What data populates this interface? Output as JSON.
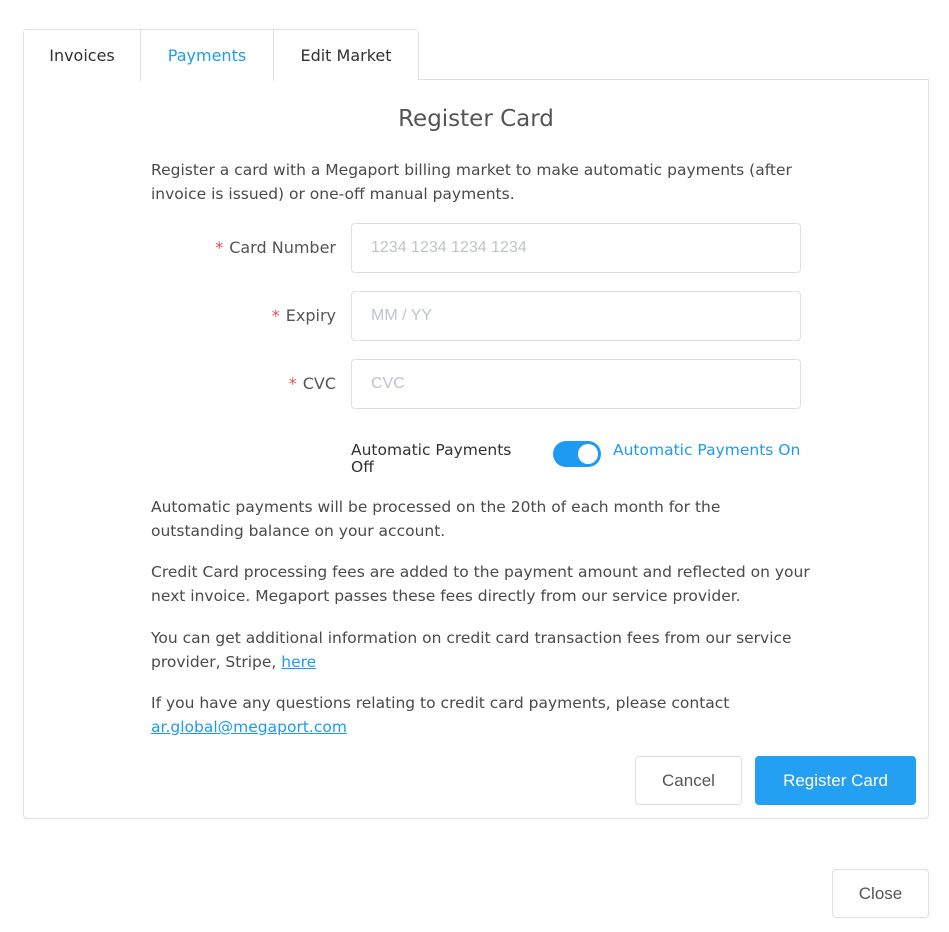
{
  "tabs": [
    {
      "label": "Invoices",
      "active": false
    },
    {
      "label": "Payments",
      "active": true
    },
    {
      "label": "Edit Market",
      "active": false
    }
  ],
  "form": {
    "title": "Register Card",
    "intro": "Register a card with a Megaport billing market to make automatic payments (after invoice is issued) or one-off manual payments.",
    "required_marker": "*",
    "card_number": {
      "label": "Card Number",
      "placeholder": "1234 1234 1234 1234",
      "value": ""
    },
    "expiry": {
      "label": "Expiry",
      "placeholder": "MM / YY",
      "value": ""
    },
    "cvc": {
      "label": "CVC",
      "placeholder": "CVC",
      "value": ""
    },
    "auto_payments": {
      "off_label": "Automatic Payments Off",
      "on_label": "Automatic Payments On",
      "enabled": true
    },
    "note_schedule": "Automatic payments will be processed on the 20th of each month for the outstanding balance on your account.",
    "note_fees": "Credit Card processing fees are added to the payment amount and reflected on your next invoice. Megaport passes these fees directly from our service provider.",
    "note_stripe_prefix": "You can get additional information on credit card transaction fees from our service provider, Stripe, ",
    "note_stripe_link": "here",
    "note_contact_prefix": "If you have any questions relating to credit card payments, please contact ",
    "note_contact_email": "ar.global@megaport.com",
    "cancel_label": "Cancel",
    "register_label": "Register Card"
  },
  "footer": {
    "close_label": "Close"
  },
  "colors": {
    "accent": "#1e9bf0",
    "required": "#e0524f",
    "border": "#dcdfe6"
  }
}
